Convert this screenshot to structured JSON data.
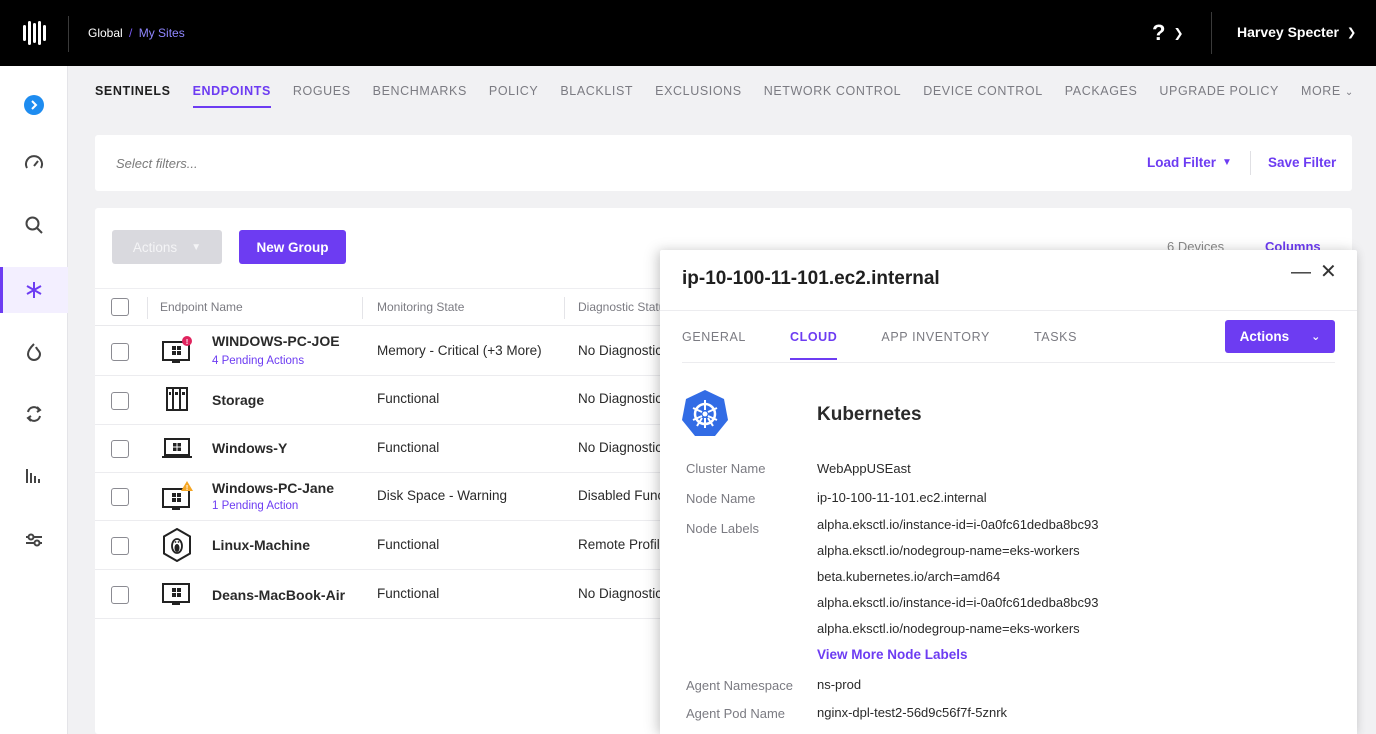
{
  "breadcrumb": {
    "global": "Global",
    "separator": "/",
    "sites": "My Sites"
  },
  "topbar": {
    "help_label": "?",
    "user_name": "Harvey Specter"
  },
  "tabs": [
    {
      "label": "SENTINELS"
    },
    {
      "label": "ENDPOINTS"
    },
    {
      "label": "ROGUES"
    },
    {
      "label": "BENCHMARKS"
    },
    {
      "label": "POLICY"
    },
    {
      "label": "BLACKLIST"
    },
    {
      "label": "EXCLUSIONS"
    },
    {
      "label": "NETWORK CONTROL"
    },
    {
      "label": "DEVICE CONTROL"
    },
    {
      "label": "PACKAGES"
    },
    {
      "label": "UPGRADE POLICY"
    },
    {
      "label": "MORE"
    }
  ],
  "filter": {
    "placeholder": "Select filters...",
    "load_label": "Load Filter",
    "save_label": "Save Filter"
  },
  "toolbar": {
    "actions_label": "Actions",
    "new_group_label": "New Group",
    "devices_count": "6 Devices",
    "columns_label": "Columns"
  },
  "table": {
    "headers": {
      "name": "Endpoint Name",
      "monitoring": "Monitoring State",
      "diagnostic": "Diagnostic Status"
    },
    "rows": [
      {
        "name": "WINDOWS-PC-JOE",
        "pending": "4 Pending Actions",
        "monitoring": "Memory - Critical (+3 More)",
        "diagnostic": "No Diagnostics"
      },
      {
        "name": "Storage",
        "pending": "",
        "monitoring": "Functional",
        "diagnostic": "No Diagnostics"
      },
      {
        "name": "Windows-Y",
        "pending": "",
        "monitoring": "Functional",
        "diagnostic": "No Diagnostics"
      },
      {
        "name": "Windows-PC-Jane",
        "pending": "1 Pending Action",
        "monitoring": "Disk Space - Warning",
        "diagnostic": "Disabled Functions"
      },
      {
        "name": "Linux-Machine",
        "pending": "",
        "monitoring": "Functional",
        "diagnostic": "Remote Profiling"
      },
      {
        "name": "Deans-MacBook-Air",
        "pending": "",
        "monitoring": "Functional",
        "diagnostic": "No Diagnostics"
      }
    ]
  },
  "panel": {
    "title": "ip-10-100-11-101.ec2.internal",
    "minimize_glyph": "—",
    "close_glyph": "✕",
    "tabs": [
      {
        "label": "GENERAL"
      },
      {
        "label": "CLOUD"
      },
      {
        "label": "APP INVENTORY"
      },
      {
        "label": "TASKS"
      }
    ],
    "actions_label": "Actions",
    "section_title": "Kubernetes",
    "cluster_label": "Cluster Name",
    "cluster_value": "WebAppUSEast",
    "node_label": "Node Name",
    "node_value": "ip-10-100-11-101.ec2.internal",
    "labels_label": "Node Labels",
    "node_labels": [
      "alpha.eksctl.io/instance-id=i-0a0fc61dedba8bc93",
      "alpha.eksctl.io/nodegroup-name=eks-workers",
      "beta.kubernetes.io/arch=amd64",
      "alpha.eksctl.io/instance-id=i-0a0fc61dedba8bc93",
      "alpha.eksctl.io/nodegroup-name=eks-workers"
    ],
    "view_more_label": "View More Node Labels",
    "namespace_label": "Agent Namespace",
    "namespace_value": "ns-prod",
    "pod_label": "Agent Pod Name",
    "pod_value": "nginx-dpl-test2-56d9c56f7f-5znrk"
  },
  "colors": {
    "accent": "#6d3cf2",
    "topbar": "#000000",
    "k8s_blue": "#326ce5",
    "alert_red": "#e0245e",
    "warning_orange": "#f5a623"
  }
}
